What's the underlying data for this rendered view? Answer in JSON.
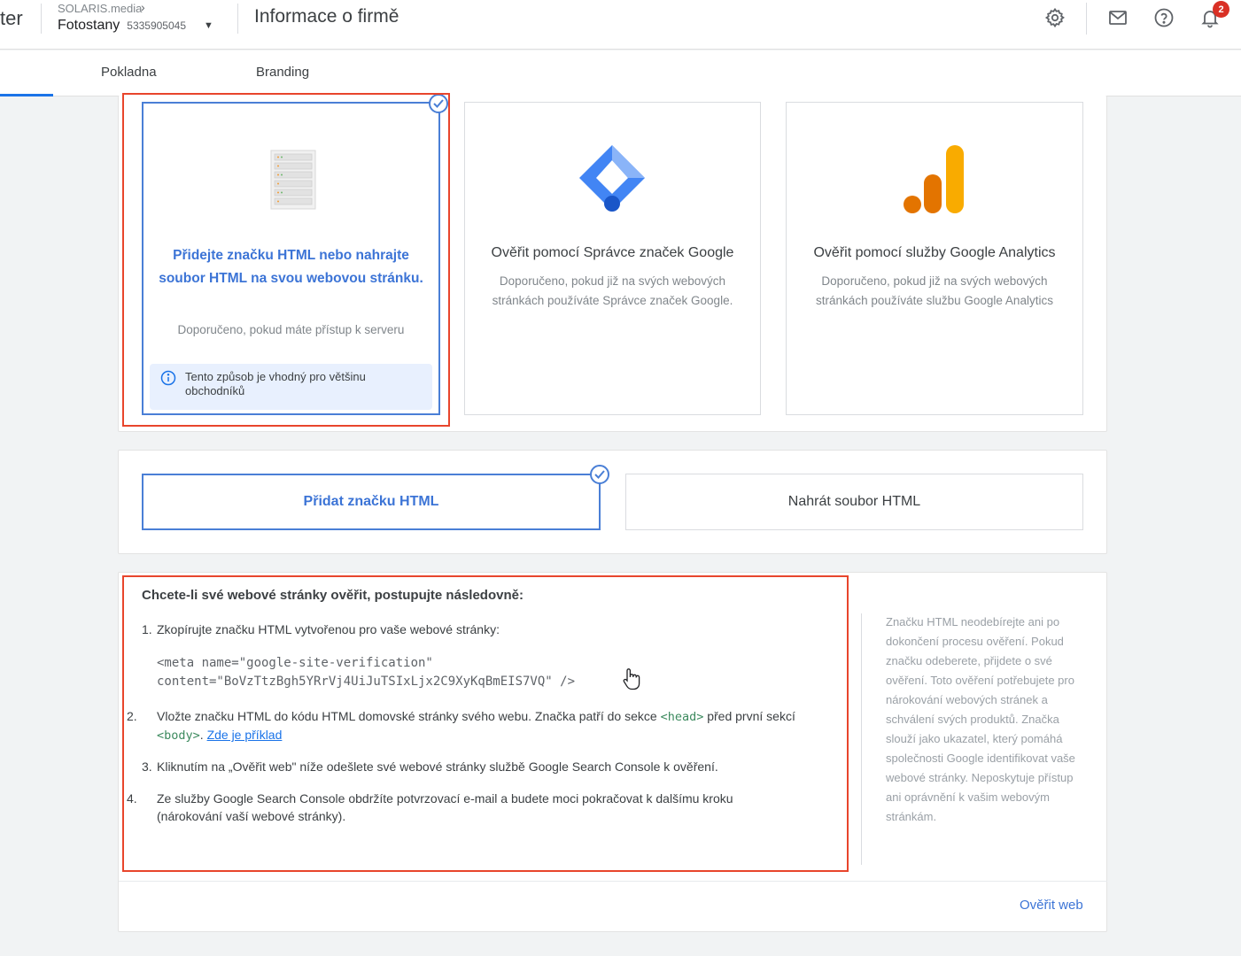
{
  "header": {
    "app_fragment": "ter",
    "account_name": "SOLARIS.media",
    "store_name": "Fotostany",
    "store_id": "5335905045",
    "page_title": "Informace o firmě",
    "notification_count": "2",
    "icons": [
      "settings-icon",
      "mail-icon",
      "help-icon",
      "bell-icon"
    ]
  },
  "tabs": [
    {
      "label": "Pokladna"
    },
    {
      "label": "Branding"
    }
  ],
  "verification_options": [
    {
      "title": "Přidejte značku HTML nebo nahrajte soubor HTML na svou webovou stránku.",
      "description": "Doporučeno, pokud máte přístup k serveru",
      "info": "Tento způsob je vhodný pro většinu obchodníků",
      "selected": true,
      "icon": "server-rack-icon"
    },
    {
      "title": "Ověřit pomocí Správce značek Google",
      "description": "Doporučeno, pokud již na svých webových stránkách používáte Správce značek Google.",
      "selected": false,
      "icon": "google-tag-manager-icon"
    },
    {
      "title": "Ověřit pomocí služby Google Analytics",
      "description": "Doporučeno, pokud již na svých webových stránkách používáte službu Google Analytics",
      "selected": false,
      "icon": "google-analytics-icon"
    }
  ],
  "method": {
    "add_tag": "Přidat značku HTML",
    "upload_file": "Nahrát soubor HTML",
    "selected": "add_tag"
  },
  "instructions": {
    "heading": "Chcete-li své webové stránky ověřit, postupujte následovně:",
    "step1": "Zkopírujte značku HTML vytvořenou pro vaše webové stránky:",
    "code_line1": "<meta name=\"google-site-verification\"",
    "code_line2": "content=\"BoVzTtzBgh5YRrVj4UiJuTSIxLjx2C9XyKqBmEIS7VQ\" />",
    "step2_a": "Vložte značku HTML do kódu HTML domovské stránky svého webu. Značka patří do sekce",
    "step2_head": "<head>",
    "step2_b": "před první sekcí",
    "step2_body": "<body>",
    "step2_link": "Zde je příklad",
    "step3": "Kliknutím na „Ověřit web\" níže odešlete své webové stránky službě Google Search Console k ověření.",
    "step4": "Ze služby Google Search Console obdržíte potvrzovací e-mail a budete moci pokračovat k dalšímu kroku (nárokování vaší webové stránky).",
    "side_note": "Značku HTML neodebírejte ani po dokončení procesu ověření. Pokud značku odeberete, přijdete o své ověření. Toto ověření potřebujete pro nárokování webových stránek a schválení svých produktů. Značka slouží jako ukazatel, který pomáhá společnosti Google identifikovat vaše webové stránky. Neposkytuje přístup ani oprávnění k vašim webovým stránkám.",
    "verify_button": "Ověřit web"
  },
  "colors": {
    "accent": "#1a73e8",
    "selected_border": "#4a7fd6",
    "highlight_red": "#e8452c",
    "gtm_blue": "#4285f4",
    "ga_orange": "#f9ab00"
  }
}
